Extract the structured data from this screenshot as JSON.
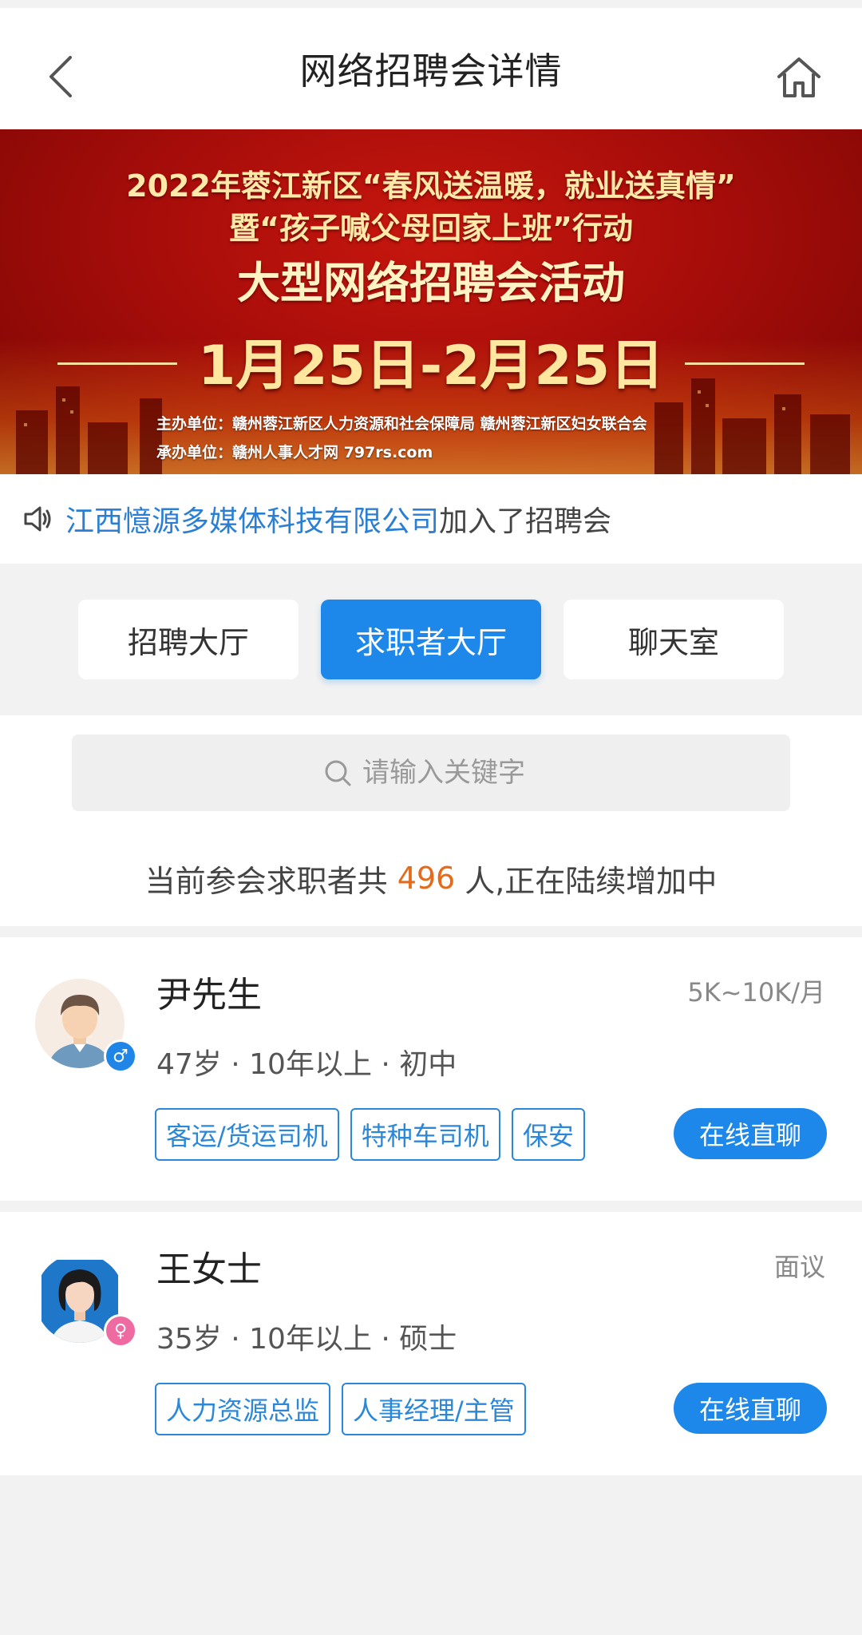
{
  "header": {
    "title": "网络招聘会详情",
    "back_icon": "chevron-left-icon",
    "home_icon": "home-icon"
  },
  "banner": {
    "line1": "2022年蓉江新区“春风送温暖，就业送真情”",
    "line2": "暨“孩子喊父母回家上班”行动",
    "line3": "大型网络招聘会活动",
    "date": "1月25日-2月25日",
    "organizer": "主办单位：赣州蓉江新区人力资源和社会保障局  赣州蓉江新区妇女联合会",
    "undertaker": "承办单位：赣州人事人才网 797rs.com",
    "colors": {
      "background": "#b3100b",
      "text": "#ffe9a8"
    }
  },
  "notice": {
    "icon": "speaker-icon",
    "company": "江西憶源多媒体科技有限公司",
    "suffix": "加入了招聘会"
  },
  "tabs": [
    {
      "label": "招聘大厅",
      "active": false
    },
    {
      "label": "求职者大厅",
      "active": true
    },
    {
      "label": "聊天室",
      "active": false
    }
  ],
  "search": {
    "placeholder": "请输入关键字",
    "icon": "search-icon"
  },
  "summary": {
    "prefix": "当前参会求职者共",
    "count": "496",
    "suffix": "人,正在陆续增加中"
  },
  "candidates": [
    {
      "name": "尹先生",
      "gender": "male",
      "gender_icon": "male-icon",
      "salary": "5K~10K/月",
      "meta": "47岁 · 10年以上 · 初中",
      "tags": [
        "客运/货运司机",
        "特种车司机",
        "保安"
      ],
      "action": "在线直聊"
    },
    {
      "name": "王女士",
      "gender": "female",
      "gender_icon": "female-icon",
      "salary": "面议",
      "meta": "35岁 · 10年以上 · 硕士",
      "tags": [
        "人力资源总监",
        "人事经理/主管"
      ],
      "action": "在线直聊"
    }
  ],
  "colors": {
    "accent": "#1e88ea",
    "count": "#e46b1c",
    "link": "#2a7fd4"
  }
}
